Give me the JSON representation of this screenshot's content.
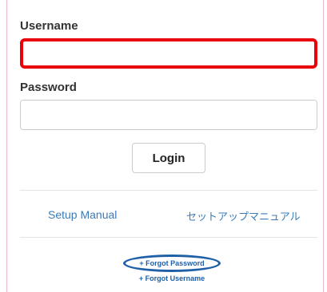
{
  "form": {
    "username_label": "Username",
    "username_value": "",
    "password_label": "Password",
    "password_value": "",
    "login_label": "Login"
  },
  "links": {
    "setup_manual_en": "Setup Manual",
    "setup_manual_jp": "セットアップマニュアル",
    "forgot_password": "+ Forgot Password",
    "forgot_username": "+ Forgot Username"
  },
  "colors": {
    "highlight_red": "#e8000b",
    "highlight_blue": "#1f5fa8",
    "link": "#3a7bb8",
    "panel_border": "#e8b4c8"
  }
}
